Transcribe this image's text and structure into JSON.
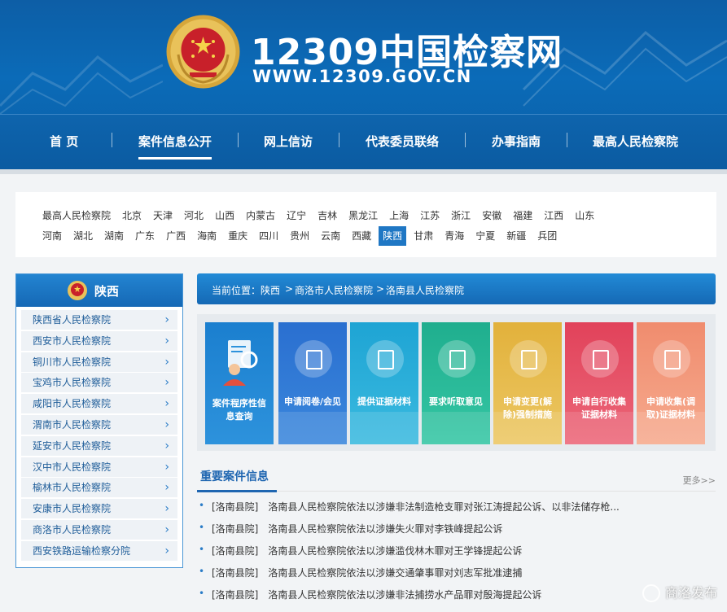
{
  "header": {
    "title": "12309中国检察网",
    "url": "WWW.12309.GOV.CN"
  },
  "nav": {
    "items": [
      "首 页",
      "案件信息公开",
      "网上信访",
      "代表委员联络",
      "办事指南",
      "最高人民检察院"
    ],
    "active_index": 1
  },
  "provinces": {
    "row1": [
      "最高人民检察院",
      "北京",
      "天津",
      "河北",
      "山西",
      "内蒙古",
      "辽宁",
      "吉林",
      "黑龙江",
      "上海",
      "江苏",
      "浙江",
      "安徽",
      "福建",
      "江西",
      "山东"
    ],
    "row2": [
      "河南",
      "湖北",
      "湖南",
      "广东",
      "广西",
      "海南",
      "重庆",
      "四川",
      "贵州",
      "云南",
      "西藏",
      "陕西",
      "甘肃",
      "青海",
      "宁夏",
      "新疆",
      "兵团"
    ],
    "active": "陕西"
  },
  "sidebar": {
    "title": "陕西",
    "items": [
      "陕西省人民检察院",
      "西安市人民检察院",
      "铜川市人民检察院",
      "宝鸡市人民检察院",
      "咸阳市人民检察院",
      "渭南市人民检察院",
      "延安市人民检察院",
      "汉中市人民检察院",
      "榆林市人民检察院",
      "安康市人民检察院",
      "商洛市人民检察院",
      "西安铁路运输检察分院"
    ]
  },
  "breadcrumb": {
    "label": "当前位置：",
    "parts": [
      "陕西",
      ">",
      "商洛市人民检察院",
      ">",
      "洛南县人民检察院"
    ]
  },
  "tiles": [
    "案件程序性信息查询",
    "申请阅卷/会见",
    "提供证据材料",
    "要求听取意见",
    "申请变更(解除)强制措施",
    "申请自行收集证据材料",
    "申请收集(调取)证据材料"
  ],
  "news": {
    "title": "重要案件信息",
    "more": "更多>>",
    "items": [
      {
        "tag": "[洛南县院]",
        "text": "洛南县人民检察院依法以涉嫌非法制造枪支罪对张江涛提起公诉、以非法储存枪..."
      },
      {
        "tag": "[洛南县院]",
        "text": "洛南县人民检察院依法以涉嫌失火罪对李铁峰提起公诉"
      },
      {
        "tag": "[洛南县院]",
        "text": "洛南县人民检察院依法以涉嫌滥伐林木罪对王学锋提起公诉"
      },
      {
        "tag": "[洛南县院]",
        "text": "洛南县人民检察院依法以涉嫌交通肇事罪对刘志军批准逮捕"
      },
      {
        "tag": "[洛南县院]",
        "text": "洛南县人民检察院依法以涉嫌非法捕捞水产品罪对殷海提起公诉"
      }
    ]
  },
  "watermark": "商洛发布",
  "colors": {
    "header_blue": "#0b5ea5",
    "accent": "#1f77c4"
  }
}
